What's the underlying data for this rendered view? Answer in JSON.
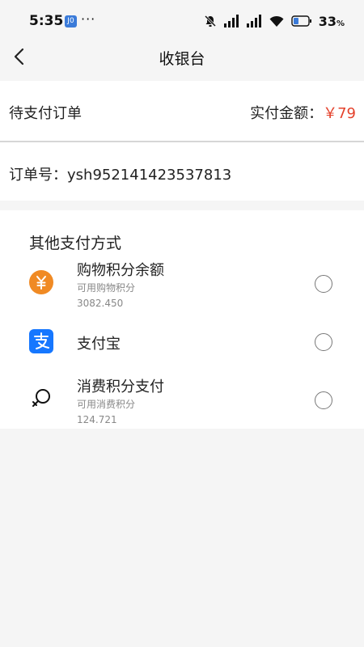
{
  "status": {
    "time": "5:35",
    "app_badge": "J0",
    "dots": "···",
    "battery_percent": "33",
    "battery_unit": "%"
  },
  "nav": {
    "title": "收银台"
  },
  "order": {
    "label": "待支付订单",
    "amount_label": "实付金额：",
    "amount_value": "￥79",
    "order_no_label": "订单号：",
    "order_no": "ysh952141423537813"
  },
  "payment": {
    "section_title": "其他支付方式",
    "methods": [
      {
        "name": "购物积分余额",
        "sub_label": "可用购物积分",
        "sub_value": "3082.450",
        "icon": "yuan-coin-icon",
        "color": "#f08a24"
      },
      {
        "name": "支付宝",
        "icon": "alipay-icon",
        "color": "#1677ff"
      },
      {
        "name": "消费积分支付",
        "sub_label": "可用消费积分",
        "sub_value": "124.721",
        "icon": "magnifier-icon",
        "color": "#111111"
      }
    ]
  }
}
